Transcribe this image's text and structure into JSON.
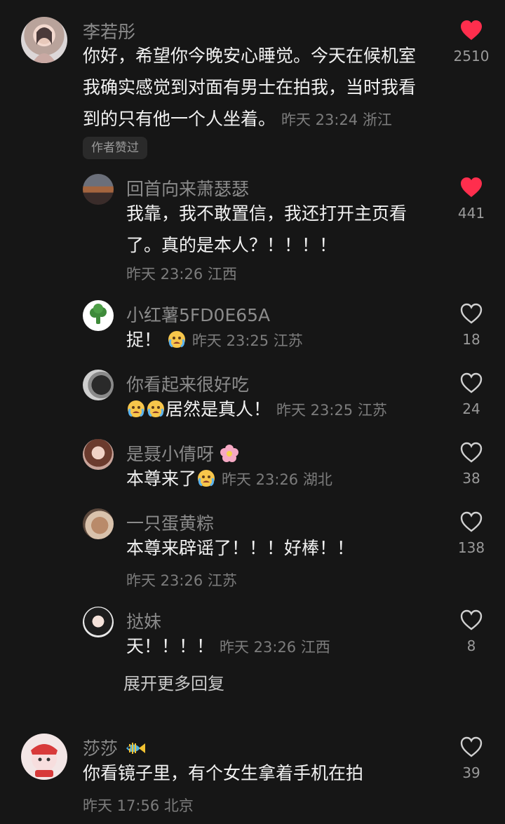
{
  "comments": [
    {
      "name": "李若彤",
      "lines": [
        "你好，希望你今晚安心睡觉。今天在候机室",
        "我确实感觉到对面有男士在拍我，当时我看",
        "到的只有他一个人坐着。"
      ],
      "time": "昨天 23:24 浙江",
      "likes": "2510",
      "badge": "作者赞过"
    },
    {
      "name": "回首向来萧瑟瑟",
      "lines": [
        "我靠，我不敢置信，我还打开主页看",
        "了。真的是本人？！！！！"
      ],
      "time": "昨天 23:26 江西",
      "likes": "441"
    },
    {
      "name": "小红薯5FD0E65A",
      "text": "捉！",
      "time": "昨天 23:25 江苏",
      "likes": "18"
    },
    {
      "name": "你看起来很好吃",
      "text": "居然是真人！",
      "time": "昨天 23:25 江苏",
      "likes": "24"
    },
    {
      "name": "是聂小倩呀",
      "text": "本尊来了",
      "time": "昨天 23:26 湖北",
      "likes": "38"
    },
    {
      "name": "一只蛋黄粽",
      "text": "本尊来辟谣了！！！好棒！！",
      "time": "昨天 23:26 江苏",
      "likes": "138"
    },
    {
      "name": "挞妹",
      "text": "天！！！！",
      "time": "昨天 23:26 江西",
      "likes": "8"
    },
    {
      "name": "莎莎",
      "text": "你看镜子里，有个女生拿着手机在拍",
      "time": "昨天 17:56 北京",
      "likes": "39"
    }
  ],
  "expand_replies": "展开更多回复",
  "colors": {
    "liked_heart": "#ff2e4d",
    "background": "#161616"
  }
}
